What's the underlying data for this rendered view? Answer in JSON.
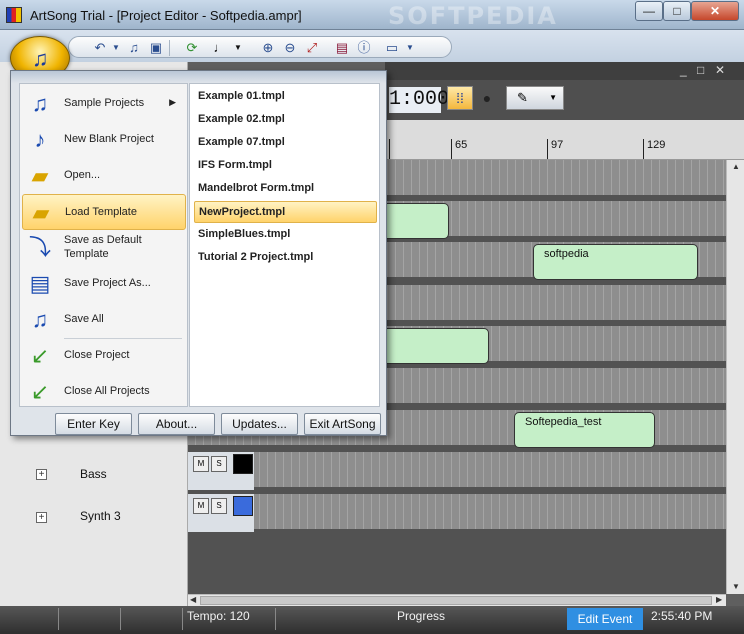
{
  "window": {
    "title": "ArtSong Trial - [Project Editor - Softpedia.ampr]",
    "watermark": "SOFTPEDIA",
    "controls": [
      "—",
      "□",
      "✕"
    ]
  },
  "child_controls": [
    "_",
    "□",
    "✕"
  ],
  "editor": {
    "time_display": "1:000",
    "ruler_labels": [
      "65",
      "97",
      "129"
    ]
  },
  "tracks": [
    {
      "name": "Bass",
      "mute": "M",
      "solo": "S",
      "color": "#000000"
    },
    {
      "name": "Synth 3",
      "mute": "M",
      "solo": "S",
      "color": "#3a6bdc"
    }
  ],
  "clips": [
    {
      "label": ""
    },
    {
      "label": "softpedia"
    },
    {
      "label": ""
    },
    {
      "label": "Softepedia_test"
    }
  ],
  "app_menu": {
    "items": [
      {
        "label": "Sample Projects",
        "icon": "music-note-icon",
        "submenu": "▶"
      },
      {
        "label": "New Blank Project",
        "icon": "new-document-icon"
      },
      {
        "label": "Open...",
        "icon": "open-folder-icon"
      },
      {
        "label": "Load Template",
        "icon": "template-folder-icon"
      },
      {
        "label": "Save as Default Template",
        "icon": "save-default-icon"
      },
      {
        "label": "Save Project As...",
        "icon": "save-as-icon"
      },
      {
        "label": "Save All",
        "icon": "save-all-icon"
      },
      {
        "label": "Close Project",
        "icon": "close-folder-icon"
      },
      {
        "label": "Close All Projects",
        "icon": "close-all-icon"
      }
    ],
    "templates": [
      "Example 01.tmpl",
      "Example 02.tmpl",
      "Example 07.tmpl",
      "IFS Form.tmpl",
      "Mandelbrot Form.tmpl",
      "NewProject.tmpl",
      "SimpleBlues.tmpl",
      "Tutorial 2 Project.tmpl"
    ],
    "buttons": [
      "Enter Key",
      "About...",
      "Updates...",
      "Exit ArtSong"
    ]
  },
  "statusbar": {
    "tempo": "Tempo:  120",
    "progress": "Progress",
    "edit_event": "Edit Event",
    "clock": "2:55:40 PM"
  }
}
